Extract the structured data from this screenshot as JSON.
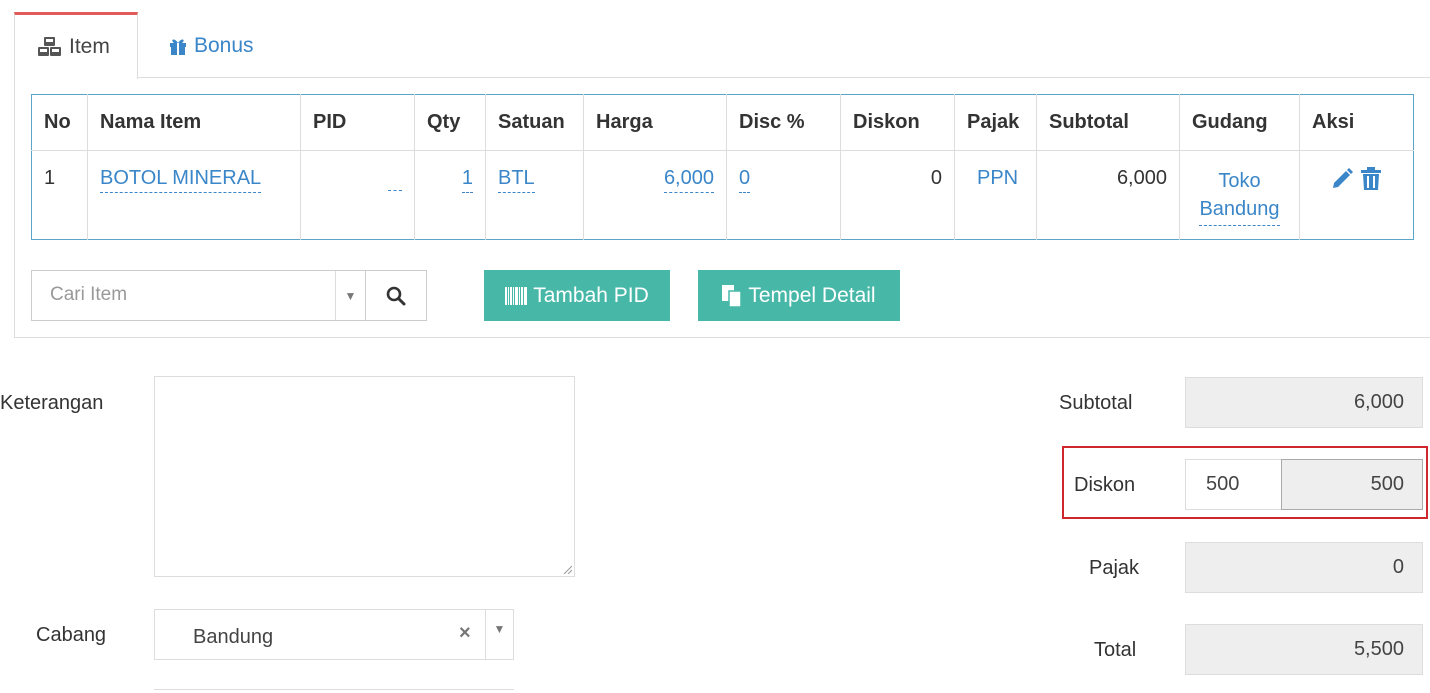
{
  "tabs": [
    {
      "label": "Item",
      "icon": "cubes-icon",
      "active": true
    },
    {
      "label": "Bonus",
      "icon": "gift-icon",
      "active": false
    }
  ],
  "table": {
    "headers": [
      "No",
      "Nama Item",
      "PID",
      "Qty",
      "Satuan",
      "Harga",
      "Disc %",
      "Diskon",
      "Pajak",
      "Subtotal",
      "Gudang",
      "Aksi"
    ],
    "rows": [
      {
        "no": "1",
        "nama_item": "BOTOL MINERAL",
        "pid": "",
        "qty": "1",
        "satuan": "BTL",
        "harga": "6,000",
        "disc_pct": "0",
        "diskon": "0",
        "pajak": "PPN",
        "subtotal": "6,000",
        "gudang_line1": "Toko",
        "gudang_line2": "Bandung"
      }
    ]
  },
  "search": {
    "placeholder": "Cari Item"
  },
  "buttons": {
    "tambah_pid": "Tambah PID",
    "tempel_detail": "Tempel Detail"
  },
  "form": {
    "keterangan_label": "Keterangan",
    "cabang_label": "Cabang",
    "cabang_value": "Bandung",
    "clear_symbol": "×"
  },
  "summary": {
    "subtotal_label": "Subtotal",
    "subtotal_value": "6,000",
    "diskon_label": "Diskon",
    "diskon_input": "500",
    "diskon_value": "500",
    "pajak_label": "Pajak",
    "pajak_value": "0",
    "total_label": "Total",
    "total_value": "5,500"
  },
  "colors": {
    "accent": "#3a86c8",
    "teal": "#47b8a8",
    "tab_active_border": "#e05b5b",
    "highlight": "#d0262e"
  }
}
